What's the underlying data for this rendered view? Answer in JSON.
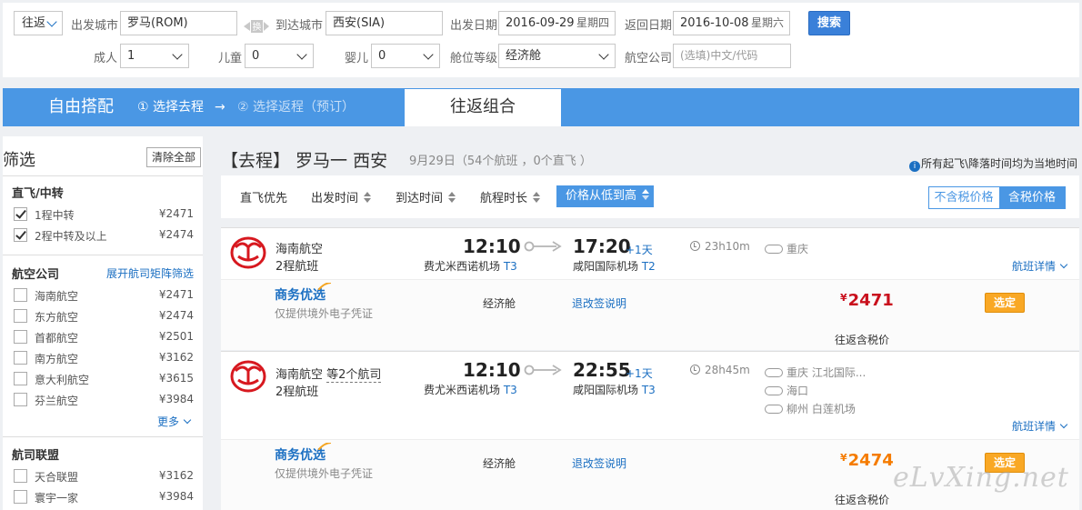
{
  "search": {
    "trip_type": "往返",
    "depart_city_label": "出发城市",
    "depart_city_value": "罗马(ROM)",
    "swap_label": "换",
    "arrive_city_label": "到达城市",
    "arrive_city_value": "西安(SIA)",
    "depart_date_label": "出发日期",
    "depart_date_value": "2016-09-29",
    "depart_weekday": "星期四",
    "return_date_label": "返回日期",
    "return_date_value": "2016-10-08",
    "return_weekday": "星期六",
    "search_button": "搜索",
    "adult_label": "成人",
    "adult_value": "1",
    "child_label": "儿童",
    "child_value": "0",
    "infant_label": "婴儿",
    "infant_value": "0",
    "cabin_label": "舱位等级",
    "cabin_value": "经济舱",
    "airline_label": "航空公司",
    "airline_placeholder": "(选填)中文/代码"
  },
  "tabs": {
    "free_combo": "自由搭配",
    "step1": "① 选择去程",
    "arrow": "→",
    "step2": "② 选择返程（预订）",
    "round_trip_combo": "往返组合"
  },
  "filter": {
    "title": "筛选",
    "clear_all": "清除全部",
    "sections": {
      "transfer": {
        "title": "直飞/中转",
        "items": [
          {
            "name": "1程中转",
            "price": "¥2471",
            "checked": true
          },
          {
            "name": "2程中转及以上",
            "price": "¥2474",
            "checked": true
          }
        ]
      },
      "airlines": {
        "title": "航空公司",
        "link": "展开航司矩阵筛选",
        "items": [
          {
            "name": "海南航空",
            "price": "¥2471"
          },
          {
            "name": "东方航空",
            "price": "¥2474"
          },
          {
            "name": "首都航空",
            "price": "¥2501"
          },
          {
            "name": "南方航空",
            "price": "¥3162"
          },
          {
            "name": "意大利航空",
            "price": "¥3615"
          },
          {
            "name": "芬兰航空",
            "price": "¥3984"
          }
        ],
        "more": "更多"
      },
      "alliance": {
        "title": "航司联盟",
        "items": [
          {
            "name": "天合联盟",
            "price": "¥3162"
          },
          {
            "name": "寰宇一家",
            "price": "¥3984"
          }
        ]
      }
    }
  },
  "results": {
    "route_title": "【去程】 罗马一 西安",
    "route_meta": "9月29日（54个航班 ，0个直飞 ）",
    "tz_note": "所有起飞\\降落时间均为当地时间",
    "sort": {
      "direct_first": "直飞优先",
      "depart_time": "出发时间",
      "arrive_time": "到达时间",
      "duration": "航程时长",
      "price_low_high": "价格从低到高"
    },
    "tax_toggle": {
      "excl": "不含税价格",
      "incl": "含税价格"
    },
    "flights": [
      {
        "airline": "海南航空",
        "airline_more": "",
        "type": "2程航班",
        "dep_time": "12:10",
        "dep_airport": "费尤米西诺机场",
        "dep_terminal": "T3",
        "arr_time": "17:20",
        "plus_day": "+1天",
        "arr_airport": "咸阳国际机场",
        "arr_terminal": "T2",
        "duration": "23h10m",
        "stops": [
          "重庆"
        ],
        "details": "航班详情",
        "brand": "商务优选",
        "brand_sub": "仅提供境外电子凭证",
        "cabin": "经济舱",
        "refund": "退改签说明",
        "price": "2471",
        "price_color": "#c9101d",
        "select": "选定",
        "tax_note": "往返含税价"
      },
      {
        "airline": "海南航空 ",
        "airline_more": "等2个航司",
        "type": "2程航班",
        "dep_time": "12:10",
        "dep_airport": "费尤米西诺机场",
        "dep_terminal": "T3",
        "arr_time": "22:55",
        "plus_day": "+1天",
        "arr_airport": "咸阳国际机场",
        "arr_terminal": "T3",
        "duration": "28h45m",
        "stops": [
          "重庆 江北国际...",
          "海口",
          "柳州 白莲机场"
        ],
        "details": "航班详情",
        "brand": "商务优选",
        "brand_sub": "仅提供境外电子凭证",
        "cabin": "经济舱",
        "refund": "退改签说明",
        "price": "2474",
        "price_color": "#f57c00",
        "select": "选定",
        "tax_note": "往返含税价"
      }
    ],
    "currency": "¥"
  },
  "watermark": "eLvXing.net",
  "colors": {
    "accent": "#4a97e4",
    "link": "#1b6fc2",
    "price_red": "#c9101d",
    "price_orange": "#f57c00",
    "select_btn": "#f9a825"
  },
  "icons": [
    "dropdown-chevron-icon",
    "swap-icon",
    "checkbox-icon",
    "sort-arrows-icon",
    "info-icon",
    "hainan-airlines-logo-icon",
    "route-arrow-icon",
    "clock-icon",
    "stopover-icon",
    "chevron-down-icon",
    "brand-spark-icon"
  ]
}
